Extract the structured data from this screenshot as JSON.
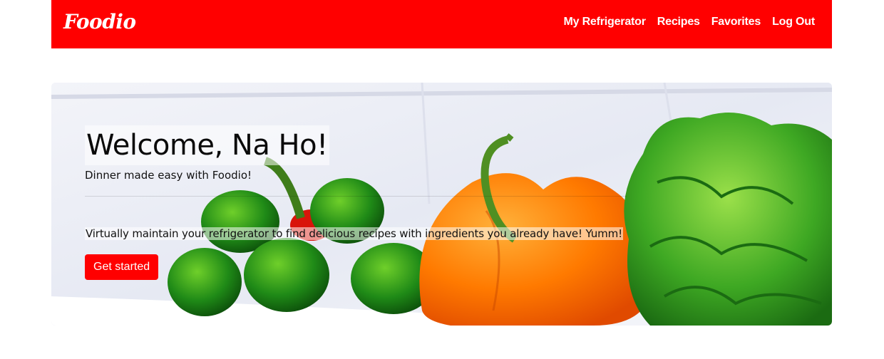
{
  "brand": {
    "name": "Foodio",
    "color": "#ff0000"
  },
  "nav": {
    "items": [
      {
        "label": "My Refrigerator"
      },
      {
        "label": "Recipes"
      },
      {
        "label": "Favorites"
      },
      {
        "label": "Log Out"
      }
    ]
  },
  "hero": {
    "title": "Welcome, Na Ho!",
    "subtitle": "Dinner made easy with Foodio!",
    "lead": "Virtually maintain your refrigerator to find delicious recipes with ingredients you already have! Yumm!",
    "cta_label": "Get started",
    "background": "refrigerator-vegetables-image"
  }
}
